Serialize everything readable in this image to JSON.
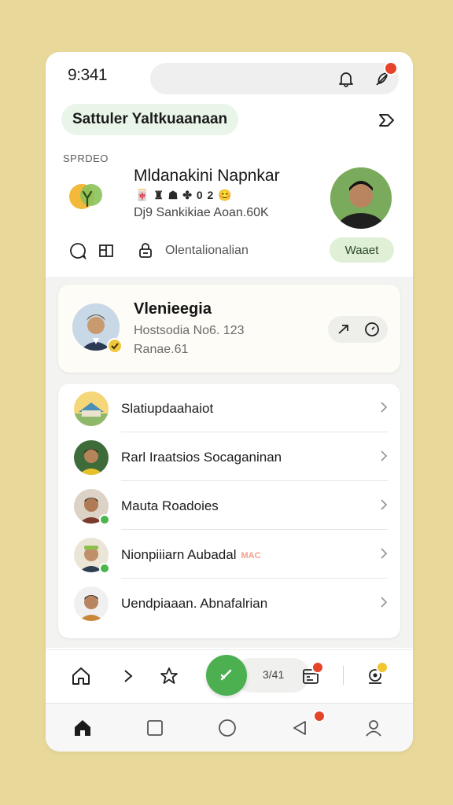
{
  "status_bar": {
    "time": "9:341"
  },
  "header": {
    "title": "Sattuler Yaltkuaanaan"
  },
  "profile": {
    "caption": "SPRDEO",
    "name": "Mldanakini Napnkar",
    "emoji_line": "🀄 ♜ ☗ ✤ 0 2 😊",
    "subtitle": "Dj9 Sankikiae Aoan.60K",
    "action_label": "Olentalionalian",
    "weather_label": "Waaet"
  },
  "featured": {
    "title": "Vlenieegia",
    "line1": "Hostsodia No6. 123",
    "line2": "Ranae.61"
  },
  "list": {
    "items": [
      {
        "label": "Slatiupdaahaiot"
      },
      {
        "label": "Rarl Iraatsios Socaganinan"
      },
      {
        "label": "Mauta Roadoies"
      },
      {
        "label": "Nionpiiiarn Aubadal",
        "tag": "MAC"
      },
      {
        "label": "Uendpiaaan. Abnafalrian"
      }
    ]
  },
  "toolbar": {
    "count": "3/41"
  },
  "colors": {
    "background": "#e8d99a",
    "accent_green": "#4caf50",
    "badge_red": "#e5432a",
    "badge_yellow": "#f2c531"
  }
}
